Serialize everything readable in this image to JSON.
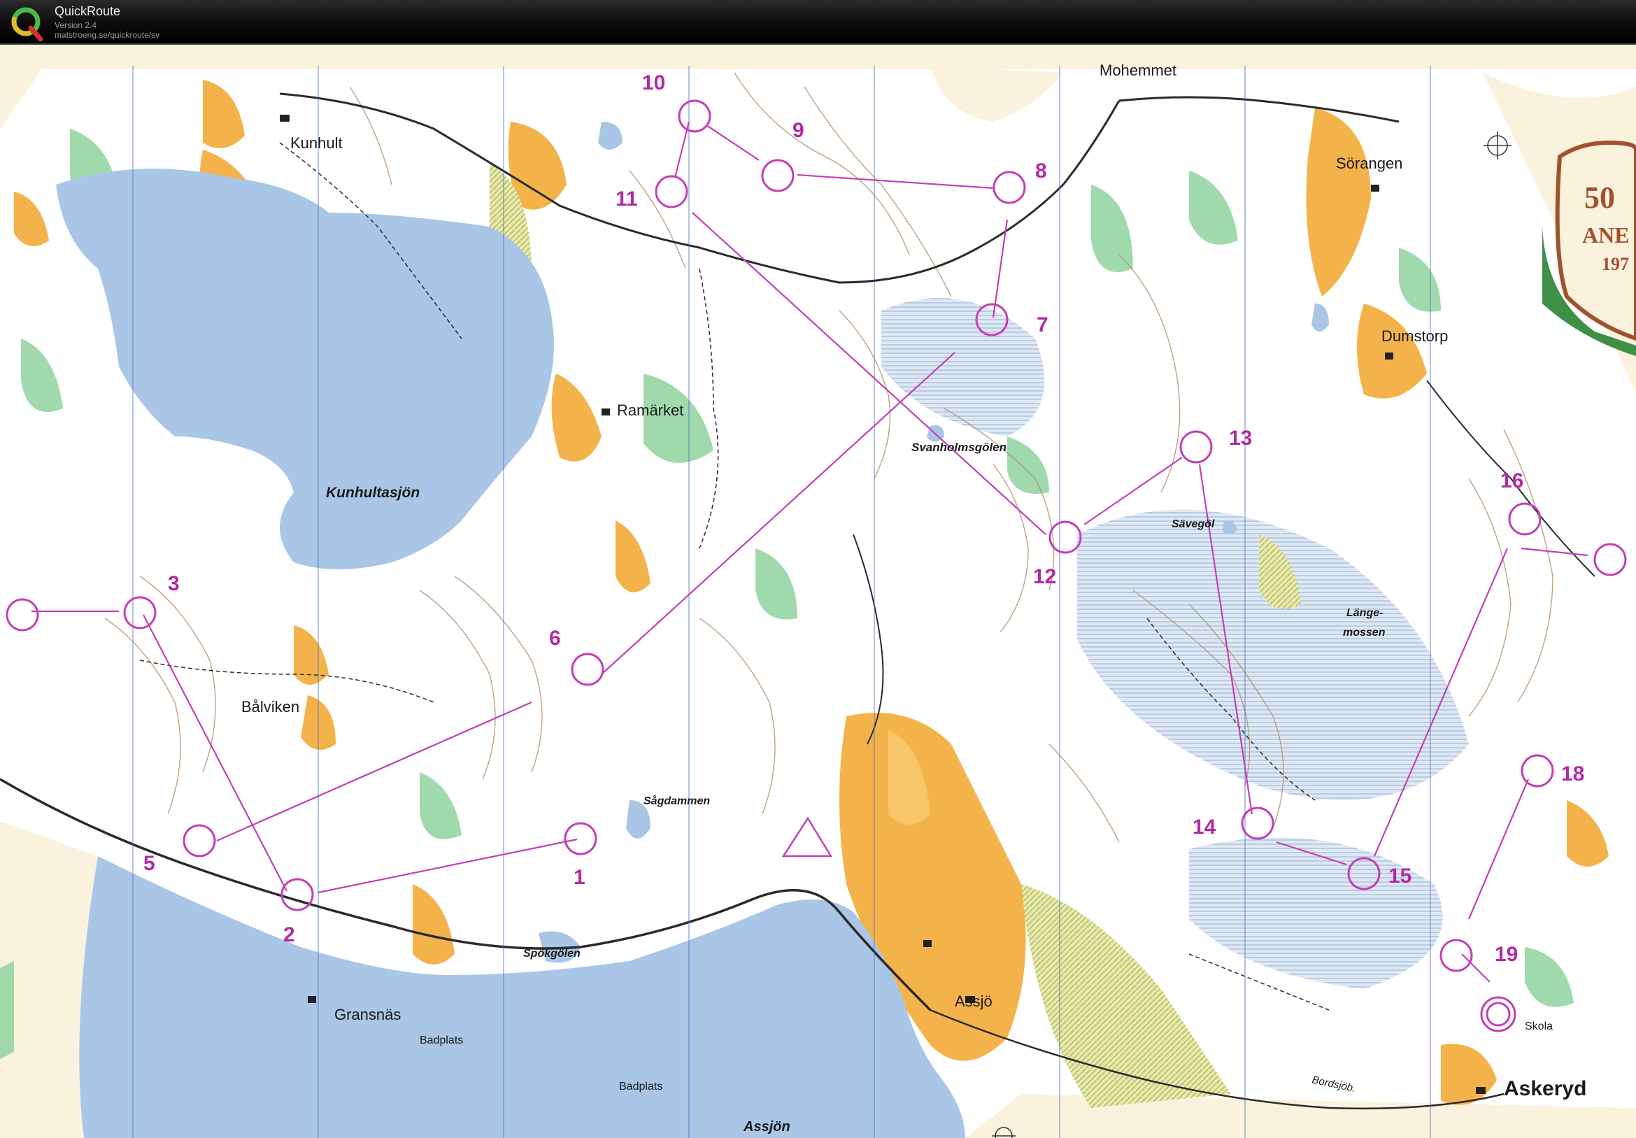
{
  "app": {
    "name": "QuickRoute",
    "version": "Version 2.4",
    "url": "matstroeng.se/quickroute/sv"
  },
  "colors": {
    "water": "#a9c6e6",
    "open_land": "#f4b34a",
    "rough_open": "#f7e3a2",
    "green": "#8fd49d",
    "course": "#c43fb6",
    "contour": "#b38a62",
    "paper": "#fbf2de"
  },
  "place_labels": {
    "mohemmet": "Mohemmet",
    "kunhult": "Kunhult",
    "sorangen": "Sörangen",
    "ramarket": "Ramärket",
    "dumstorp": "Dumstorp",
    "svanholmsgolen": "Svanholmsgölen",
    "kunhultasjon": "Kunhultasjön",
    "savegol": "Sävegöl",
    "lange": "Länge-",
    "mossen": "mossen",
    "balviken": "Bålviken",
    "sagdammen": "Sågdammen",
    "spokgolen": "Spökgölen",
    "gransnas": "Gransnäs",
    "badplats1": "Badplats",
    "badplats2": "Badplats",
    "assjo": "Assjö",
    "assjon": "Assjön",
    "skola": "Skola",
    "askeryd": "Askeryd",
    "bordsjob": "Bordsjöb."
  },
  "emblem": {
    "line1": "50",
    "line2": "ANE",
    "line3": "197"
  },
  "controls": [
    {
      "num": "1",
      "label": "1"
    },
    {
      "num": "2",
      "label": "2"
    },
    {
      "num": "3",
      "label": "3"
    },
    {
      "num": "5",
      "label": "5"
    },
    {
      "num": "6",
      "label": "6"
    },
    {
      "num": "7",
      "label": "7"
    },
    {
      "num": "8",
      "label": "8"
    },
    {
      "num": "9",
      "label": "9"
    },
    {
      "num": "10",
      "label": "10"
    },
    {
      "num": "11",
      "label": "11"
    },
    {
      "num": "12",
      "label": "12"
    },
    {
      "num": "13",
      "label": "13"
    },
    {
      "num": "14",
      "label": "14"
    },
    {
      "num": "15",
      "label": "15"
    },
    {
      "num": "16",
      "label": "16"
    },
    {
      "num": "18",
      "label": "18"
    },
    {
      "num": "19",
      "label": "19"
    }
  ]
}
